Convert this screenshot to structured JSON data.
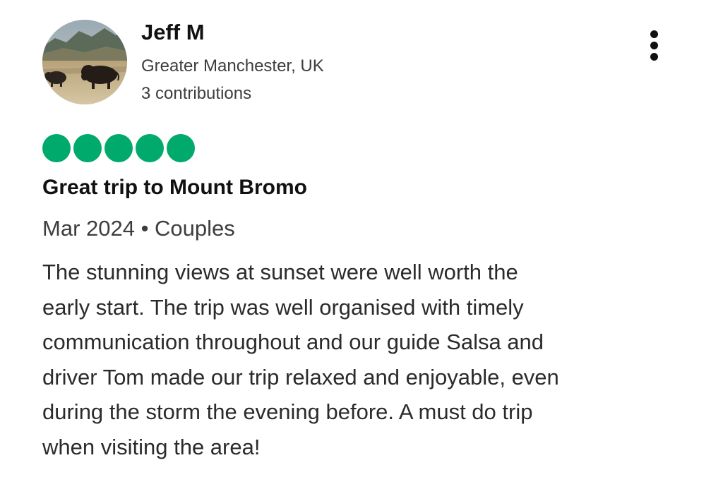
{
  "reviewer": {
    "name": "Jeff M",
    "location": "Greater Manchester, UK",
    "contributions": "3 contributions",
    "avatar_icon": "bison-landscape-photo"
  },
  "menu": {
    "icon": "more-vertical-icon"
  },
  "rating": {
    "value": 5,
    "max": 5,
    "color": "#00aa6c"
  },
  "review": {
    "title": "Great trip to Mount Bromo",
    "meta": "Mar 2024 • Couples",
    "body_lines": [
      "The stunning views at sunset were well worth the",
      "early start. The trip was well organised with timely",
      "communication throughout and our guide Salsa and",
      "driver Tom made our trip relaxed and enjoyable, even",
      "during the storm the evening before. A must do trip",
      "when visiting the area!"
    ]
  }
}
